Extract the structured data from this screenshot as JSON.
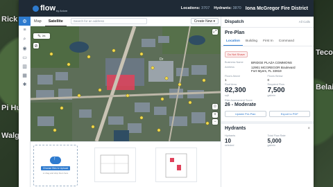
{
  "background": {
    "labels": [
      "Rick Shie",
      "Pi Hut",
      "Tecos",
      "Belai",
      "Walgr"
    ]
  },
  "app": {
    "logo_text": "flow",
    "logo_sub": "by Axiom",
    "stats": {
      "locations_label": "Locations:",
      "locations_value": "3707",
      "hydrants_label": "Hydrants:",
      "hydrants_value": "3870"
    },
    "district": "Iona McGregor Fire District"
  },
  "rail": {
    "icons": [
      "gear-icon",
      "layers-icon",
      "search-icon",
      "pin-icon",
      "truck-icon",
      "chart-icon",
      "building-icon",
      "settings-icon"
    ]
  },
  "map": {
    "tabs": [
      "Map",
      "Satellite"
    ],
    "active_tab": "Satellite",
    "search_placeholder": "Search for an address",
    "create_label": "Create New",
    "street_label": "Dr",
    "zoom_in": "+",
    "zoom_out": "−"
  },
  "docs": {
    "upload_button": "Choose files to Upload",
    "upload_hint": "or drag and drop them here"
  },
  "panel": {
    "dispatch_title": "Dispatch",
    "dispatch_right": "All Calls",
    "preplan_title": "Pre-Plan",
    "tabs": [
      "Location",
      "Building",
      "First In",
      "Command"
    ],
    "active_tab": "Location",
    "alert": "Do Not Shave",
    "business_label": "Business Name",
    "business_value": "BRIDGE PLAZA COMMONS",
    "address_label": "Address",
    "address_line1": "12901 MCGREGOR Boulevard",
    "address_line2": "Fort Myers, FL 33919",
    "floors_above_label": "Floors Above",
    "floors_above_value": "1",
    "floors_below_label": "Floors Below",
    "floors_below_value": "0",
    "roof_area_label": "Roof Area",
    "roof_area_value": "82,300",
    "roof_area_unit": "sqft",
    "required_flow_label": "Required Flow",
    "required_flow_value": "7,500",
    "required_flow_unit": "gal/min",
    "risk_label": "Risk Assessment Score",
    "risk_value": "26 - Moderate",
    "update_btn": "Update Pre-Plan",
    "export_btn": "Export to PDF",
    "hydrants_title": "Hydrants",
    "hydrants_count_label": "Hydrants",
    "hydrants_count_value": "10",
    "hydrants_count_unit": "selected",
    "total_flow_label": "Total Flow Rate",
    "total_flow_value": "5,000",
    "total_flow_unit": "gal/min"
  },
  "colors": {
    "accent": "#2e7bcf",
    "topbar": "#1f2a36",
    "hydrant": "#f2d94e",
    "building_highlight": "#e0415a"
  }
}
